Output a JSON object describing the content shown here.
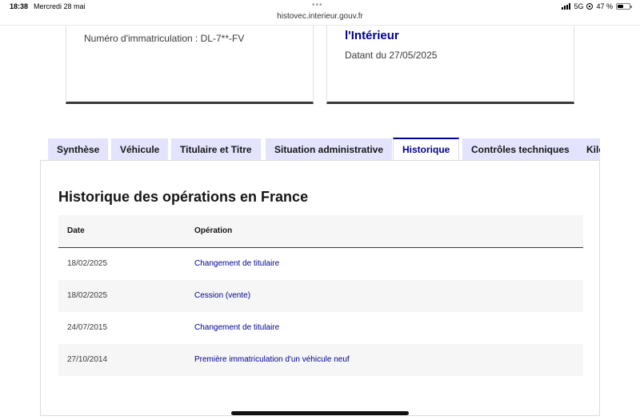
{
  "status_bar": {
    "time": "18:38",
    "date": "Mercredi 28 mai",
    "network": "5G",
    "battery": "47 %",
    "battery_level": 0.47
  },
  "browser": {
    "url": "histovec.interieur.gouv.fr"
  },
  "cards": {
    "plate": "Numéro d'immatriculation : DL-7**-FV",
    "source_title": "l'Intérieur",
    "source_date": "Datant du 27/05/2025"
  },
  "tabs": [
    {
      "label": "Synthèse",
      "active": false
    },
    {
      "label": "Véhicule",
      "active": false
    },
    {
      "label": "Titulaire et Titre",
      "active": false
    },
    {
      "label": "Situation administrative",
      "active": false
    },
    {
      "label": "Historique",
      "active": true
    },
    {
      "label": "Contrôles techniques",
      "active": false
    },
    {
      "label": "Kilo",
      "active": false
    }
  ],
  "history": {
    "title": "Historique des opérations en France",
    "columns": {
      "date": "Date",
      "operation": "Opération"
    },
    "rows": [
      {
        "date": "18/02/2025",
        "operation": "Changement de titulaire"
      },
      {
        "date": "18/02/2025",
        "operation": "Cession (vente)"
      },
      {
        "date": "24/07/2015",
        "operation": "Changement de titulaire"
      },
      {
        "date": "27/10/2014",
        "operation": "Première immatriculation d'un véhicule neuf"
      }
    ]
  },
  "colors": {
    "accent": "#000091",
    "tab_bg": "#e3e3fd",
    "row_alt": "#f6f6f6"
  }
}
